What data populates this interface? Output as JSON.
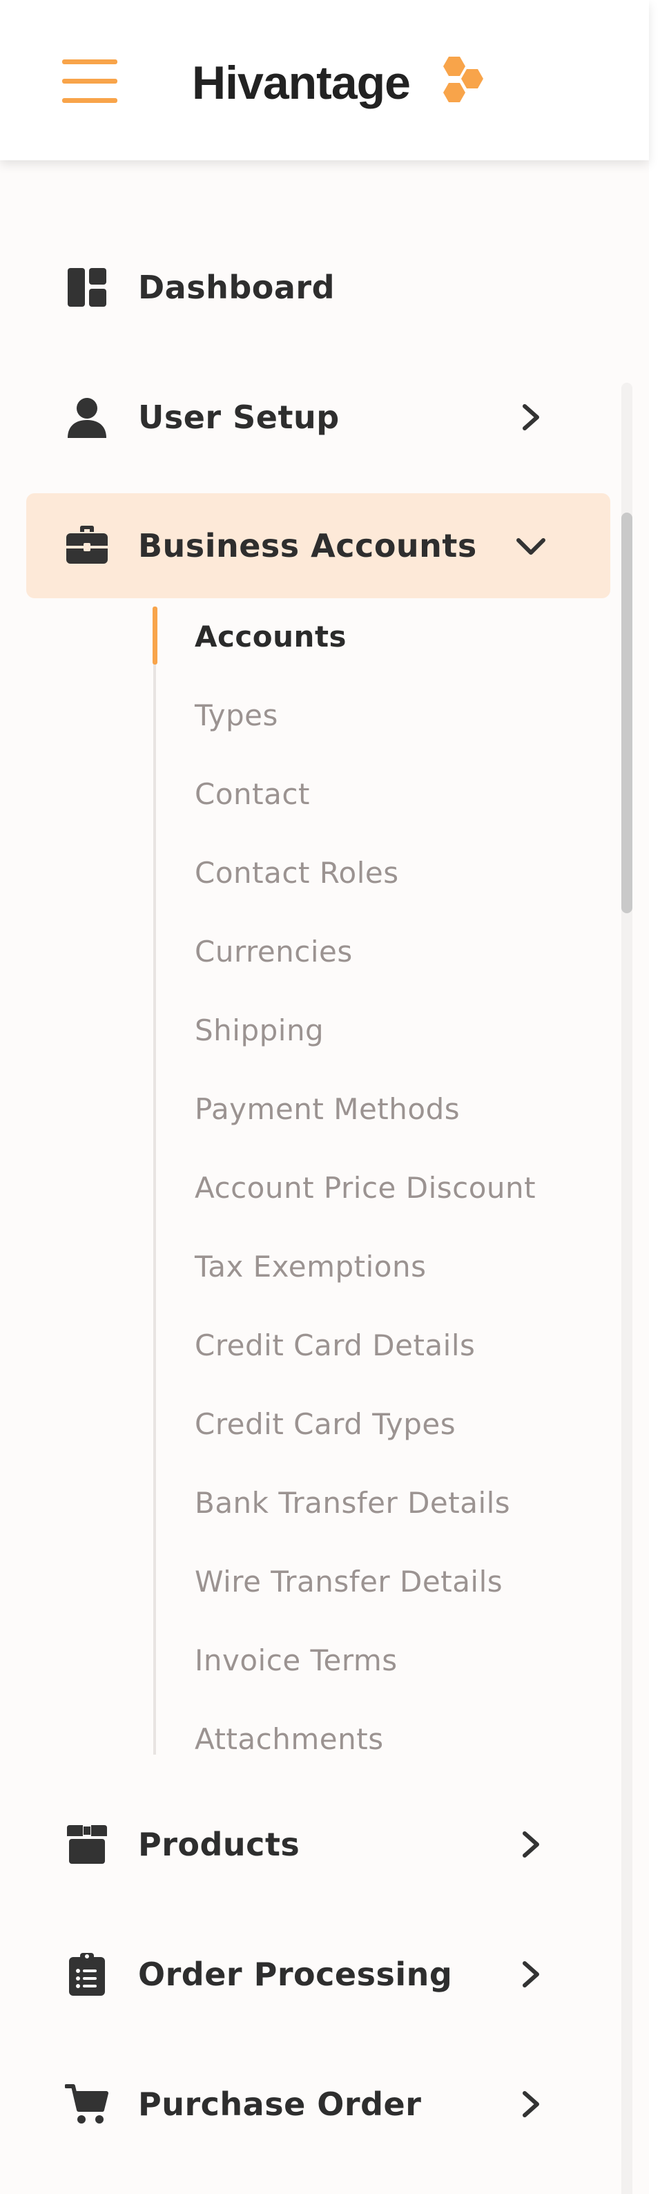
{
  "header": {
    "menu_icon": "hamburger-menu-icon",
    "brand": "Hivantage",
    "brand_mark_icon": "honeycomb-logo-icon",
    "accent_color": "#f8a44a"
  },
  "nav": {
    "items": [
      {
        "label": "Dashboard",
        "icon": "dashboard-icon",
        "chevron": "none"
      },
      {
        "label": "User Setup",
        "icon": "user-icon",
        "chevron": "right"
      },
      {
        "label": "Business Accounts",
        "icon": "briefcase-icon",
        "chevron": "down",
        "active": true
      },
      {
        "label": "Products",
        "icon": "box-icon",
        "chevron": "right"
      },
      {
        "label": "Order Processing",
        "icon": "clipboard-list-icon",
        "chevron": "right"
      },
      {
        "label": "Purchase Order",
        "icon": "cart-icon",
        "chevron": "right"
      }
    ],
    "business_accounts_subitems": [
      "Accounts",
      "Types",
      "Contact",
      "Contact Roles",
      "Currencies",
      "Shipping",
      "Payment Methods",
      "Account Price Discount",
      "Tax Exemptions",
      "Credit Card Details",
      "Credit Card Types",
      "Bank Transfer Details",
      "Wire Transfer Details",
      "Invoice Terms",
      "Attachments"
    ],
    "current_subitem": "Accounts",
    "active_background": "#fde9d8"
  }
}
